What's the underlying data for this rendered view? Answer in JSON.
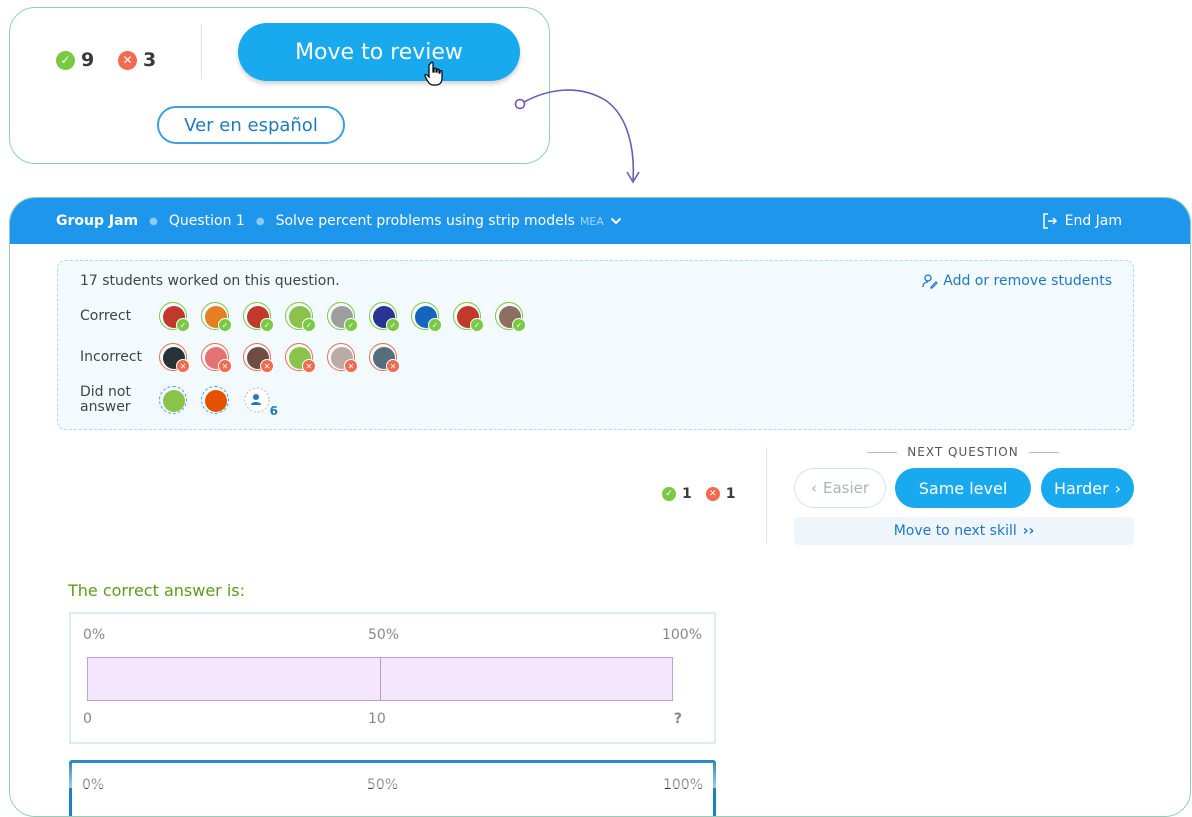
{
  "callout": {
    "correct_count": "9",
    "incorrect_count": "3",
    "review_button": "Move to review",
    "spanish_button": "Ver en español"
  },
  "topbar": {
    "app": "Group Jam",
    "question": "Question 1",
    "skill": "Solve percent problems using strip models",
    "skill_code": "MEA",
    "end_label": "End Jam"
  },
  "summary": {
    "worked_text": "17 students worked on this question.",
    "add_remove": "Add or remove students",
    "labels": {
      "correct": "Correct",
      "incorrect": "Incorrect",
      "did_not_1": "Did not",
      "did_not_2": "answer"
    },
    "correct_avatars": [
      "#c0392b",
      "#e67e22",
      "#c0392b",
      "#8bc34a",
      "#9e9e9e",
      "#283593",
      "#1565c0",
      "#c0392b",
      "#8d6e63"
    ],
    "incorrect_avatars": [
      "#263238",
      "#e57373",
      "#6d4c41",
      "#8bc34a",
      "#bcaaa4",
      "#546e7a"
    ],
    "noanswer_avatars": [
      "#8bc34a",
      "#e65100"
    ],
    "more_count": "6"
  },
  "score_small": {
    "correct": "1",
    "incorrect": "1"
  },
  "next": {
    "title": "NEXT QUESTION",
    "easier": "Easier",
    "same": "Same level",
    "harder": "Harder",
    "next_skill": "Move to next skill"
  },
  "answer": {
    "title": "The correct answer is:",
    "pct_0": "0%",
    "pct_50": "50%",
    "pct_100": "100%",
    "val_0": "0",
    "val_mid": "10",
    "val_end": "?"
  },
  "colors": {
    "accent": "#19a9ef",
    "correct": "#7ac943",
    "incorrect": "#f26b4f",
    "topbar": "#1e96ec"
  }
}
